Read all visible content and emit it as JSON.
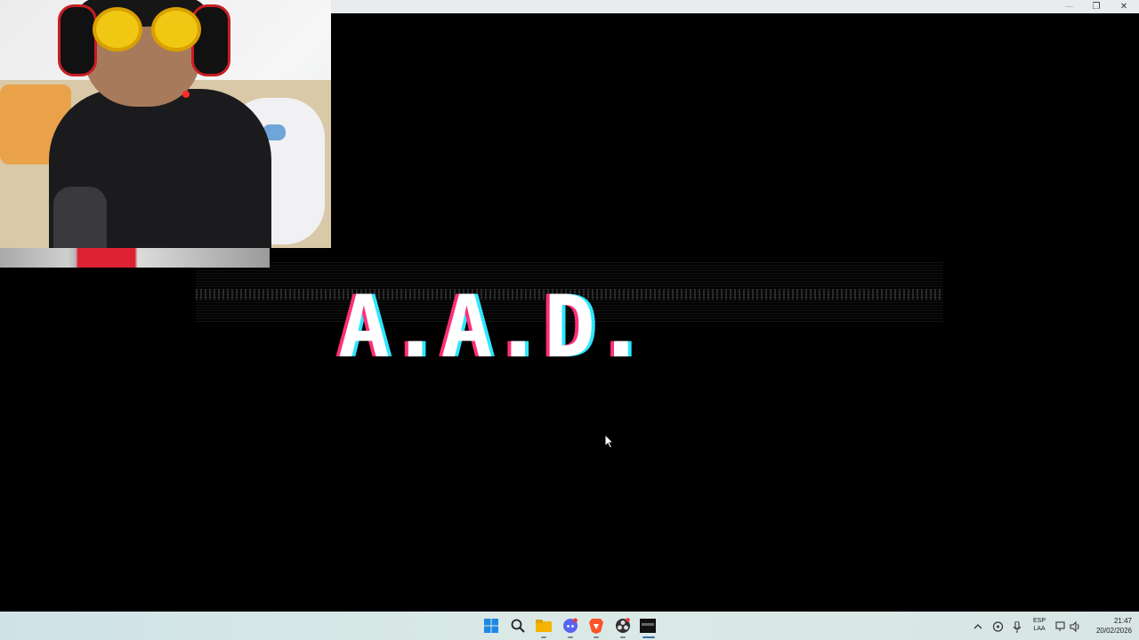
{
  "window": {
    "minimize_glyph": "—",
    "maximize_glyph": "❐",
    "close_glyph": "✕"
  },
  "game": {
    "title_text": "A.A.D."
  },
  "taskbar": {
    "icons": [
      "windows-start-icon",
      "search-icon",
      "file-explorer-icon",
      "discord-icon",
      "brave-browser-icon",
      "obs-icon",
      "game-window-icon"
    ],
    "tray": {
      "lang_line1": "ESP",
      "lang_line2": "LAA",
      "time": "21:47",
      "date": "20/02/2026"
    }
  },
  "colors": {
    "glitch_magenta": "#ff2d7a",
    "glitch_cyan": "#2ee6ff",
    "taskbar_bg": "#d7e5e4"
  }
}
